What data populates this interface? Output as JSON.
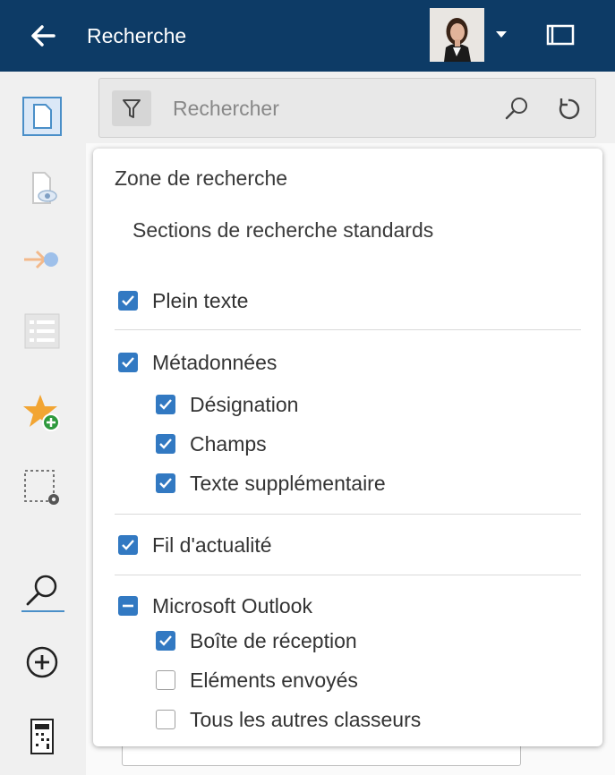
{
  "header": {
    "title": "Recherche",
    "background": "#0d3b66"
  },
  "search": {
    "placeholder": "Rechercher"
  },
  "rail": {
    "items": [
      "new-document-icon",
      "preview-icon",
      "workflow-icon",
      "list-icon",
      "favorite-add-icon",
      "selection-settings-icon",
      "search-icon",
      "add-circle-icon",
      "calculator-icon"
    ]
  },
  "dropdown": {
    "heading": "Zone de recherche",
    "subheading": "Sections de recherche standards",
    "groups": [
      {
        "label": "Plein texte",
        "state": "checked",
        "children": []
      },
      {
        "label": "Métadonnées",
        "state": "checked",
        "children": [
          {
            "label": "Désignation",
            "state": "checked"
          },
          {
            "label": "Champs",
            "state": "checked"
          },
          {
            "label": "Texte supplémentaire",
            "state": "checked"
          }
        ]
      },
      {
        "label": "Fil d'actualité",
        "state": "checked",
        "children": []
      },
      {
        "label": "Microsoft Outlook",
        "state": "partial",
        "children": [
          {
            "label": "Boîte de réception",
            "state": "checked"
          },
          {
            "label": "Eléments envoyés",
            "state": "unchecked"
          },
          {
            "label": "Tous les autres classeurs",
            "state": "unchecked"
          }
        ]
      }
    ]
  },
  "colors": {
    "accent": "#3279c2",
    "header": "#0d3b66"
  }
}
